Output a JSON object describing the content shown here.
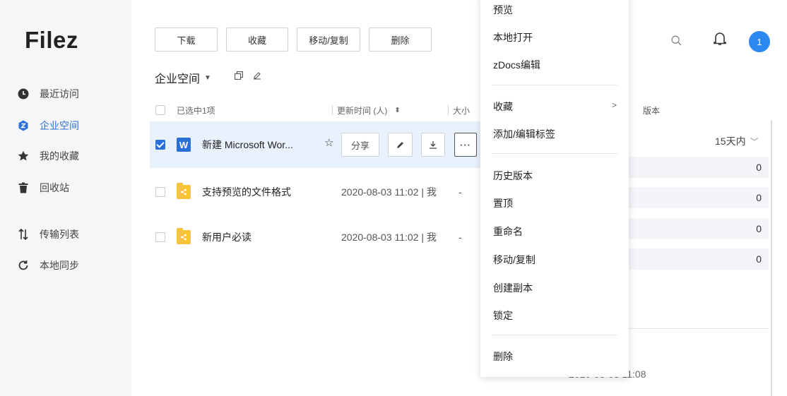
{
  "app": {
    "logo": "Filez"
  },
  "sidebar": {
    "items": [
      {
        "label": "最近访问",
        "icon": "clock-icon"
      },
      {
        "label": "企业空间",
        "icon": "enterprise-icon",
        "active": true
      },
      {
        "label": "我的收藏",
        "icon": "star-icon"
      },
      {
        "label": "回收站",
        "icon": "trash-icon"
      },
      {
        "label": "传输列表",
        "icon": "transfer-icon"
      },
      {
        "label": "本地同步",
        "icon": "sync-icon"
      }
    ]
  },
  "toolbar": {
    "download": "下载",
    "favorite": "收藏",
    "move_copy": "移动/复制",
    "delete": "删除"
  },
  "breadcrumb": {
    "title": "企业空间"
  },
  "columns": {
    "selected": "已选中1项",
    "updated": "更新时间 (人)",
    "size": "大小",
    "version": "版本"
  },
  "files": [
    {
      "name": "新建 Microsoft Wor...",
      "type": "word",
      "selected": true,
      "actions": {
        "share": "分享"
      }
    },
    {
      "name": "支持预览的文件格式",
      "type": "folder",
      "date": "2020-08-03 11:02 | 我",
      "size": "-"
    },
    {
      "name": "新用户必读",
      "type": "folder",
      "date": "2020-08-03 11:02 | 我",
      "size": "-"
    }
  ],
  "header": {
    "avatar_count": "1"
  },
  "right_panel": {
    "filter": "15天内",
    "versions": [
      "0",
      "0",
      "0",
      "0"
    ],
    "date": "2020-08-03 11:08"
  },
  "context_menu": {
    "items": [
      "预览",
      "本地打开",
      "zDocs编辑",
      "收藏",
      "添加/编辑标签",
      "历史版本",
      "置顶",
      "重命名",
      "移动/复制",
      "创建副本",
      "锁定",
      "删除"
    ]
  },
  "colors": {
    "accent": "#2b6fd8",
    "folder": "#f7c33b",
    "sidebar_bg": "#f5f6f8"
  }
}
